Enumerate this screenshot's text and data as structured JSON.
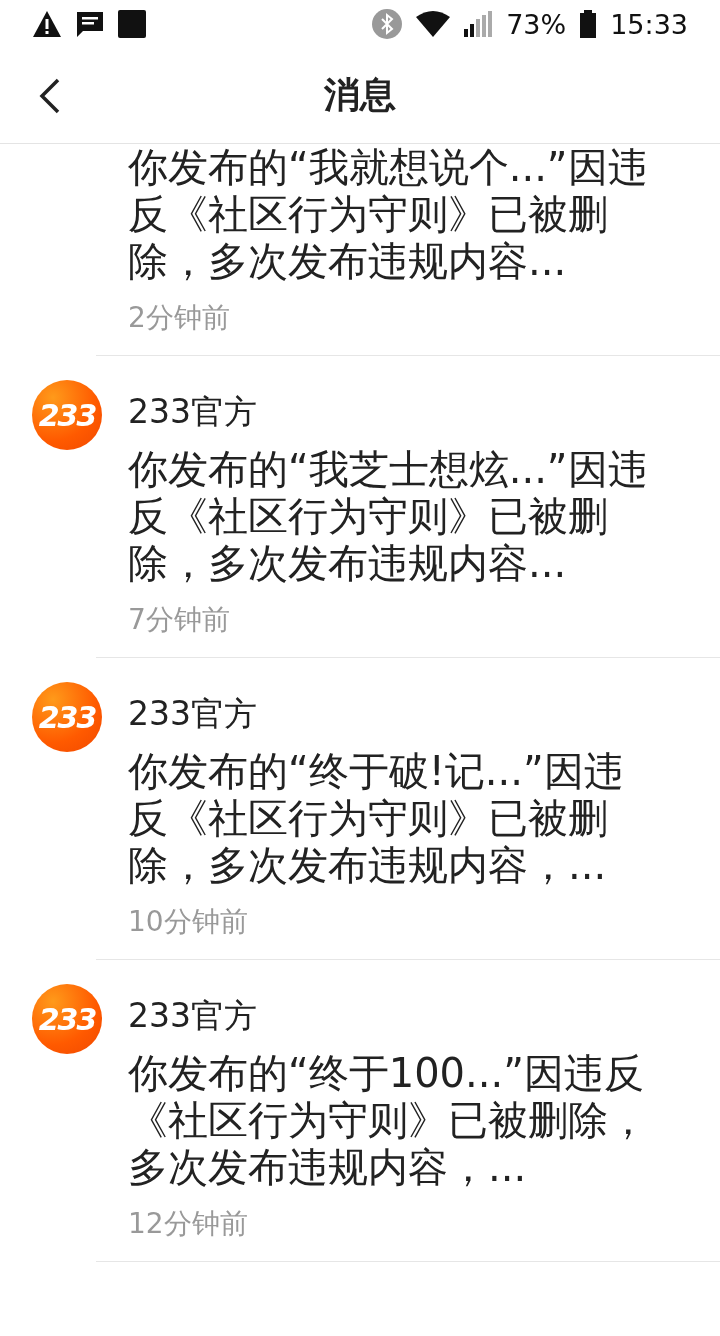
{
  "status_bar": {
    "battery": "73%",
    "time": "15:33"
  },
  "header": {
    "title": "消息"
  },
  "messages": [
    {
      "kind": "partial",
      "text": "你发布的“我就想说个...”因违反《社区行为守则》已被删除，多次发布违规内容...",
      "time": "2分钟前"
    },
    {
      "kind": "full",
      "avatar": "233",
      "sender": "233官方",
      "text": "你发布的“我芝士想炫...”因违反《社区行为守则》已被删除，多次发布违规内容...",
      "time": "7分钟前"
    },
    {
      "kind": "full",
      "avatar": "233",
      "sender": "233官方",
      "text": "你发布的“终于破!记...”因违反《社区行为守则》已被删除，多次发布违规内容，...",
      "time": "10分钟前"
    },
    {
      "kind": "full",
      "avatar": "233",
      "sender": "233官方",
      "text": "你发布的“终于100...”因违反《社区行为守则》已被删除，多次发布违规内容，...",
      "time": "12分钟前"
    }
  ]
}
